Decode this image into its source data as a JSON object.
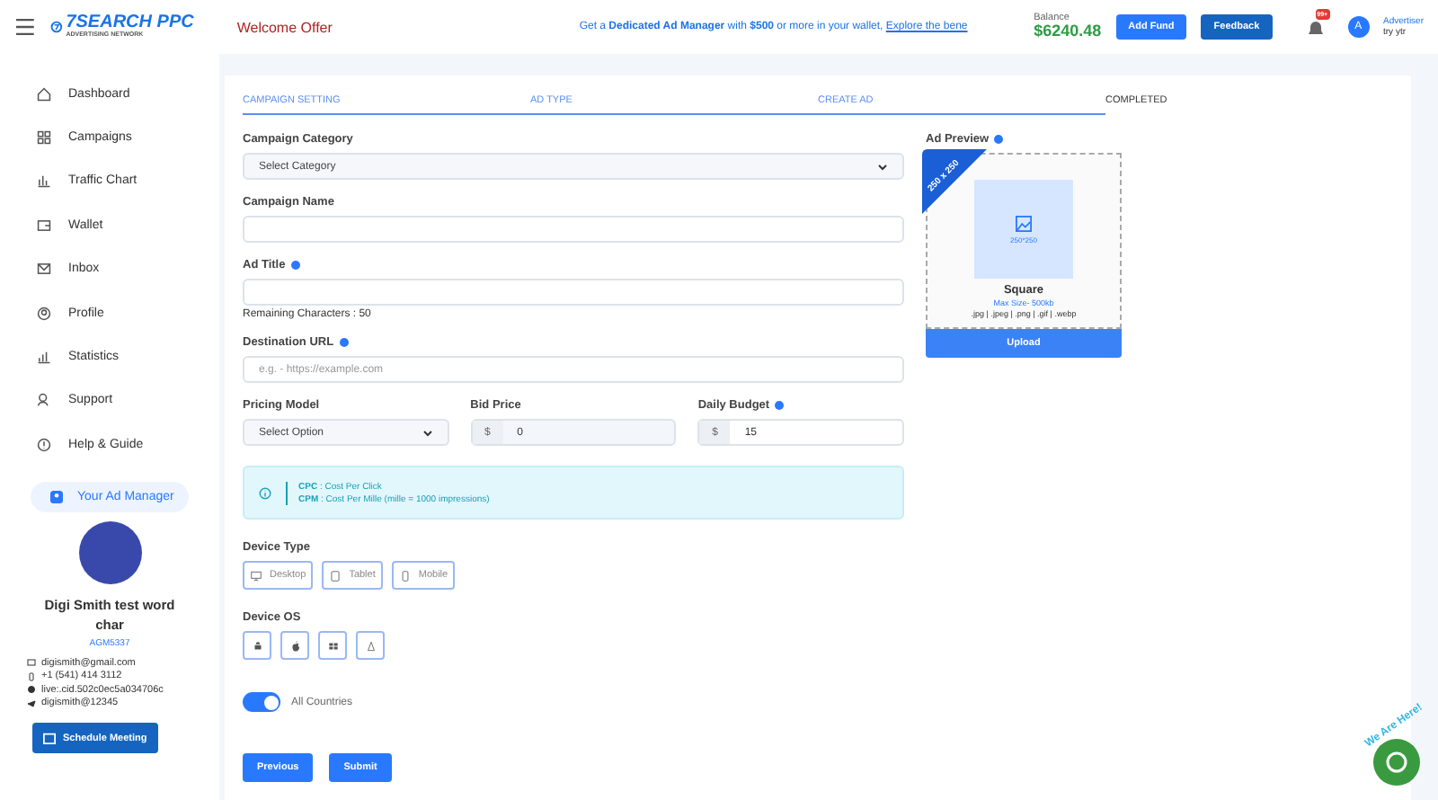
{
  "header": {
    "logo_title": "7SEARCH PPC",
    "logo_subtitle": "ADVERTISING NETWORK",
    "welcome": "Welcome Offer",
    "promo": "Get a **Dedicated Ad Manager** with **$500** or more in your wallet, ",
    "promo_link": "Explore the bene",
    "balance_label": "Balance",
    "balance": "$6240.48",
    "buttons": [
      "Add Fund",
      "Feedback"
    ],
    "notification_badge": "99+",
    "avatar_letter": "A",
    "role": "Advertiser",
    "user": "try ytr"
  },
  "sidebar": {
    "items": [
      {
        "label": "Dashboard"
      },
      {
        "label": "Campaigns"
      },
      {
        "label": "Traffic Chart"
      },
      {
        "label": "Wallet"
      },
      {
        "label": "Inbox"
      },
      {
        "label": "Profile"
      },
      {
        "label": "Statistics"
      },
      {
        "label": "Support"
      },
      {
        "label": "Help & Guide"
      }
    ],
    "manager_label": "Your Ad Manager",
    "manager_name": "Digi Smith test word char",
    "manager_id": "AGM5337",
    "contacts": [
      {
        "kind": "email",
        "text": "digismith@gmail.com"
      },
      {
        "kind": "phone",
        "text": "+1 (541) 414 3112"
      },
      {
        "kind": "skype",
        "text": "live:.cid.502c0ec5a034706c"
      },
      {
        "kind": "telegram",
        "text": "digismith@12345"
      }
    ],
    "schedule_button": "Schedule Meeting"
  },
  "steps": [
    {
      "label": "CAMPAIGN SETTING",
      "done": true
    },
    {
      "label": "AD TYPE",
      "done": true
    },
    {
      "label": "CREATE AD",
      "done": true
    },
    {
      "label": "COMPLETED",
      "done": false
    }
  ],
  "form": {
    "category": {
      "label": "Campaign Category",
      "value": "Select Category"
    },
    "campaign_name": {
      "label": "Campaign Name"
    },
    "ad_title": {
      "label": "Ad Title",
      "remaining": "Remaining Characters : 50"
    },
    "destination": {
      "label": "Destination URL",
      "placeholder": "e.g. - https://example.com"
    },
    "pricing": {
      "label": "Pricing Model",
      "value": "Select Option"
    },
    "bid": {
      "label": "Bid Price",
      "prefix": "$",
      "value": "0"
    },
    "budget": {
      "label": "Daily Budget",
      "prefix": "$",
      "value": "15"
    },
    "info": [
      "**CPC** : Cost Per Click",
      "**CPM** : Cost Per Mille (mille = 1000 impressions)"
    ],
    "device_type_label": "Device Type",
    "device_types": [
      {
        "label": "Desktop"
      },
      {
        "label": "Tablet"
      },
      {
        "label": "Mobile"
      }
    ],
    "device_os_label": "Device OS",
    "countries": {
      "label": "All Countries",
      "on": true
    },
    "buttons": [
      "Previous",
      "Submit"
    ]
  },
  "preview": {
    "label": "Ad Preview",
    "ribbon": "250 x 250",
    "size_text": "250*250",
    "title": "Square",
    "max_size": "Max Size- 500kb",
    "formats": ".jpg | .jpeg | .png | .gif | .webp",
    "upload": "Upload"
  },
  "chat": {
    "label": "We Are Here!"
  }
}
